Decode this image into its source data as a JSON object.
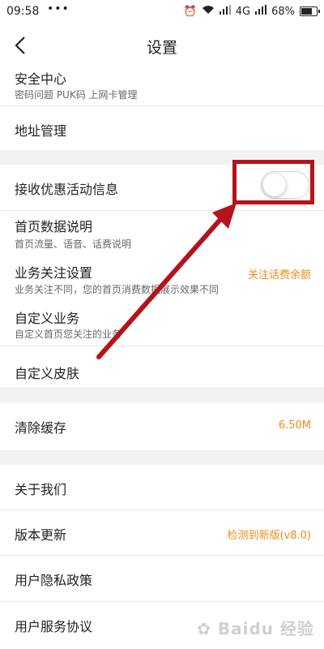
{
  "status": {
    "time": "09:58",
    "dots": "•••",
    "network": "4G",
    "battery": "68%"
  },
  "nav": {
    "title": "设置"
  },
  "group1": [
    {
      "title": "安全中心",
      "subtitle": "密码问题 PUK码 上网卡管理"
    },
    {
      "title": "地址管理"
    }
  ],
  "group2": [
    {
      "title": "接收优惠活动信息",
      "toggle": false
    },
    {
      "title": "首页数据说明",
      "subtitle": "首页流量、语音、话费说明"
    },
    {
      "title": "业务关注设置",
      "subtitle": "业务关注不同，您的首页消费数据展示效果不同",
      "value": "关注话费余额"
    },
    {
      "title": "自定义业务",
      "subtitle": "自定义首页您关注的业务"
    },
    {
      "title": "自定义皮肤"
    }
  ],
  "group3": [
    {
      "title": "清除缓存",
      "value": "6.50M"
    }
  ],
  "group4": [
    {
      "title": "关于我们"
    },
    {
      "title": "版本更新",
      "value": "检测到新版(v8.0)"
    },
    {
      "title": "用户隐私政策"
    },
    {
      "title": "用户服务协议"
    }
  ],
  "watermark": "Baidu 经验",
  "colors": {
    "accent": "#f08c19",
    "annotation": "#b5131c"
  }
}
